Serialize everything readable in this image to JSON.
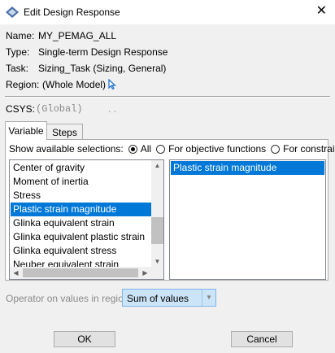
{
  "window": {
    "title": "Edit Design Response",
    "close_glyph": "✕"
  },
  "info": {
    "name_label": "Name:",
    "name_value": "MY_PEMAG_ALL",
    "type_label": "Type:",
    "type_value": "Single-term Design Response",
    "task_label": "Task:",
    "task_value": "Sizing_Task (Sizing, General)",
    "region_label": "Region:",
    "region_value": "(Whole Model)"
  },
  "csys": {
    "label": "CSYS:",
    "value": "(Global)",
    "dots": ". ."
  },
  "tabs": [
    {
      "label": "Variable",
      "active": true
    },
    {
      "label": "Steps",
      "active": false
    }
  ],
  "show": {
    "label": "Show available selections:",
    "options": [
      {
        "label": "All",
        "selected": true
      },
      {
        "label": "For objective functions",
        "selected": false
      },
      {
        "label": "For constraints",
        "selected": false
      }
    ]
  },
  "available_list": [
    {
      "label": "Center of gravity",
      "selected": false
    },
    {
      "label": "Moment of inertia",
      "selected": false
    },
    {
      "label": "Stress",
      "selected": false
    },
    {
      "label": "Plastic strain magnitude",
      "selected": true
    },
    {
      "label": "Glinka equivalent strain",
      "selected": false
    },
    {
      "label": "Glinka equivalent plastic strain",
      "selected": false
    },
    {
      "label": "Glinka equivalent stress",
      "selected": false
    },
    {
      "label": "Neuber equivalent strain",
      "selected": false
    }
  ],
  "selected_list": [
    "Plastic strain magnitude"
  ],
  "operator": {
    "label": "Operator on values in region:",
    "value": "Sum of values"
  },
  "buttons": {
    "ok": "OK",
    "cancel": "Cancel"
  },
  "icons": {
    "app": "abaqus-icon",
    "region_pick": "cursor-arrow-icon"
  },
  "colors": {
    "selection": "#0078d7",
    "select_bg": "#cce4f7"
  }
}
